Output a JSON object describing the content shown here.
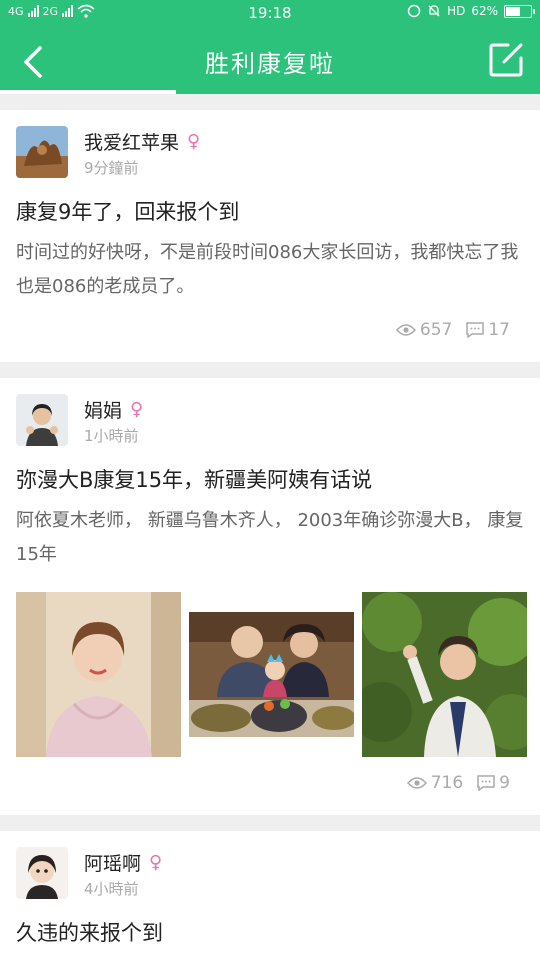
{
  "status": {
    "network_left": "4G",
    "network_right": "2G",
    "time": "19:18",
    "hd": "HD",
    "battery_pct_text": "62%",
    "battery_level": 0.62
  },
  "header": {
    "title": "胜利康复啦",
    "active_tab_indicator": true,
    "back_icon": "chevron-left-icon",
    "edit_icon": "edit-icon"
  },
  "posts": [
    {
      "user": "我爱红苹果",
      "gender_icon": "♀",
      "time": "9分鐘前",
      "title": "康复9年了，回来报个到",
      "body": "时间过的好快呀，不是前段时间086大家长回访，我都快忘了我也是086的老成员了。",
      "views": "657",
      "comments": "17"
    },
    {
      "user": "娟娟",
      "gender_icon": "♀",
      "time": "1小時前",
      "title": "弥漫大B康复15年，新疆美阿姨有话说",
      "body": "阿依夏木老师， 新疆乌鲁木齐人， 2003年确诊弥漫大B， 康复15年",
      "views": "716",
      "comments": "9"
    },
    {
      "user": "阿瑶啊",
      "gender_icon": "♀",
      "time": "4小時前",
      "title": "久违的来报个到"
    }
  ],
  "colors": {
    "brand": "#2cc27b",
    "female": "#ee6fb2"
  }
}
